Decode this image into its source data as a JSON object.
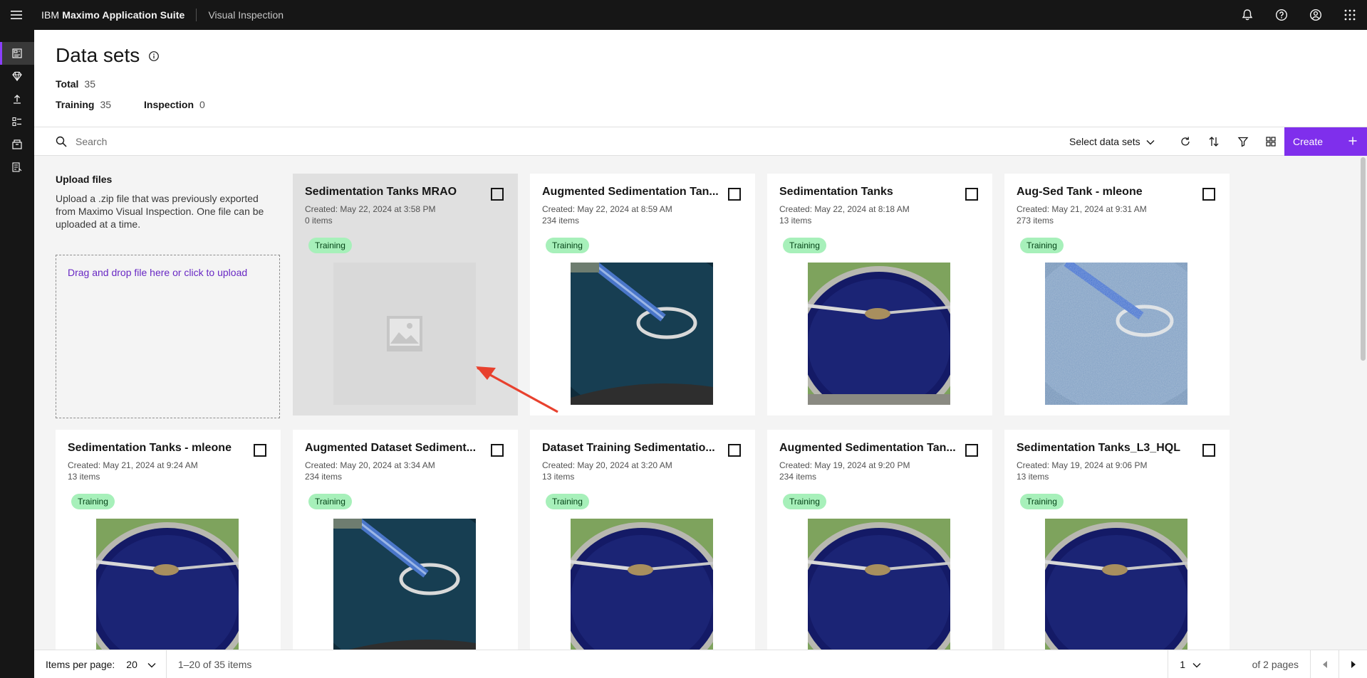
{
  "header": {
    "brand_prefix": "IBM",
    "brand_bold": "Maximo Application Suite",
    "product": "Visual Inspection"
  },
  "page": {
    "title": "Data sets",
    "total_label": "Total",
    "total_value": "35",
    "training_label": "Training",
    "training_value": "35",
    "inspection_label": "Inspection",
    "inspection_value": "0"
  },
  "toolbar": {
    "search_placeholder": "Search",
    "select_label": "Select data sets",
    "create_label": "Create"
  },
  "upload": {
    "title": "Upload files",
    "description": "Upload a .zip file that was previously exported from Maximo Visual Inspection. One file can be uploaded at a time.",
    "dropzone": "Drag and drop file here or click to upload"
  },
  "cards": [
    {
      "title": "Sedimentation Tanks MRAO",
      "created": "Created: May 22, 2024 at 3:58 PM",
      "items": "0 items",
      "tag": "Training",
      "image": "empty"
    },
    {
      "title": "Augmented Sedimentation Tan...",
      "created": "Created: May 22, 2024 at 8:59 AM",
      "items": "234 items",
      "tag": "Training",
      "image": "bridge"
    },
    {
      "title": "Sedimentation Tanks",
      "created": "Created: May 22, 2024 at 8:18 AM",
      "items": "13 items",
      "tag": "Training",
      "image": "circle"
    },
    {
      "title": "Aug-Sed Tank - mleone",
      "created": "Created: May 21, 2024 at 9:31 AM",
      "items": "273 items",
      "tag": "Training",
      "image": "noisy"
    },
    {
      "title": "Sedimentation Tanks - mleone",
      "created": "Created: May 21, 2024 at 9:24 AM",
      "items": "13 items",
      "tag": "Training",
      "image": "circle"
    },
    {
      "title": "Augmented Dataset Sediment...",
      "created": "Created: May 20, 2024 at 3:34 AM",
      "items": "234 items",
      "tag": "Training",
      "image": "bridge"
    },
    {
      "title": "Dataset Training Sedimentatio...",
      "created": "Created: May 20, 2024 at 3:20 AM",
      "items": "13 items",
      "tag": "Training",
      "image": "circle"
    },
    {
      "title": "Augmented Sedimentation Tan...",
      "created": "Created: May 19, 2024 at 9:20 PM",
      "items": "234 items",
      "tag": "Training",
      "image": "circle"
    },
    {
      "title": "Sedimentation Tanks_L3_HQL",
      "created": "Created: May 19, 2024 at 9:06 PM",
      "items": "13 items",
      "tag": "Training",
      "image": "circle"
    }
  ],
  "pagination": {
    "items_per_page_label": "Items per page:",
    "items_per_page": "20",
    "range": "1–20 of 35 items",
    "page": "1",
    "of_pages": "of 2 pages"
  },
  "icons": {
    "top": [
      "notification-icon",
      "help-icon",
      "user-avatar-icon",
      "app-switcher-icon"
    ],
    "rail": [
      "datasets-icon",
      "models-icon",
      "deploy-icon",
      "projects-icon",
      "inventory-icon",
      "reports-icon"
    ]
  },
  "colors": {
    "accent": "#8a3ffc",
    "create_button": "#7f2fec",
    "tag_bg": "#a7f0ba",
    "tag_text": "#044317",
    "annotation_arrow": "#e8412e"
  }
}
